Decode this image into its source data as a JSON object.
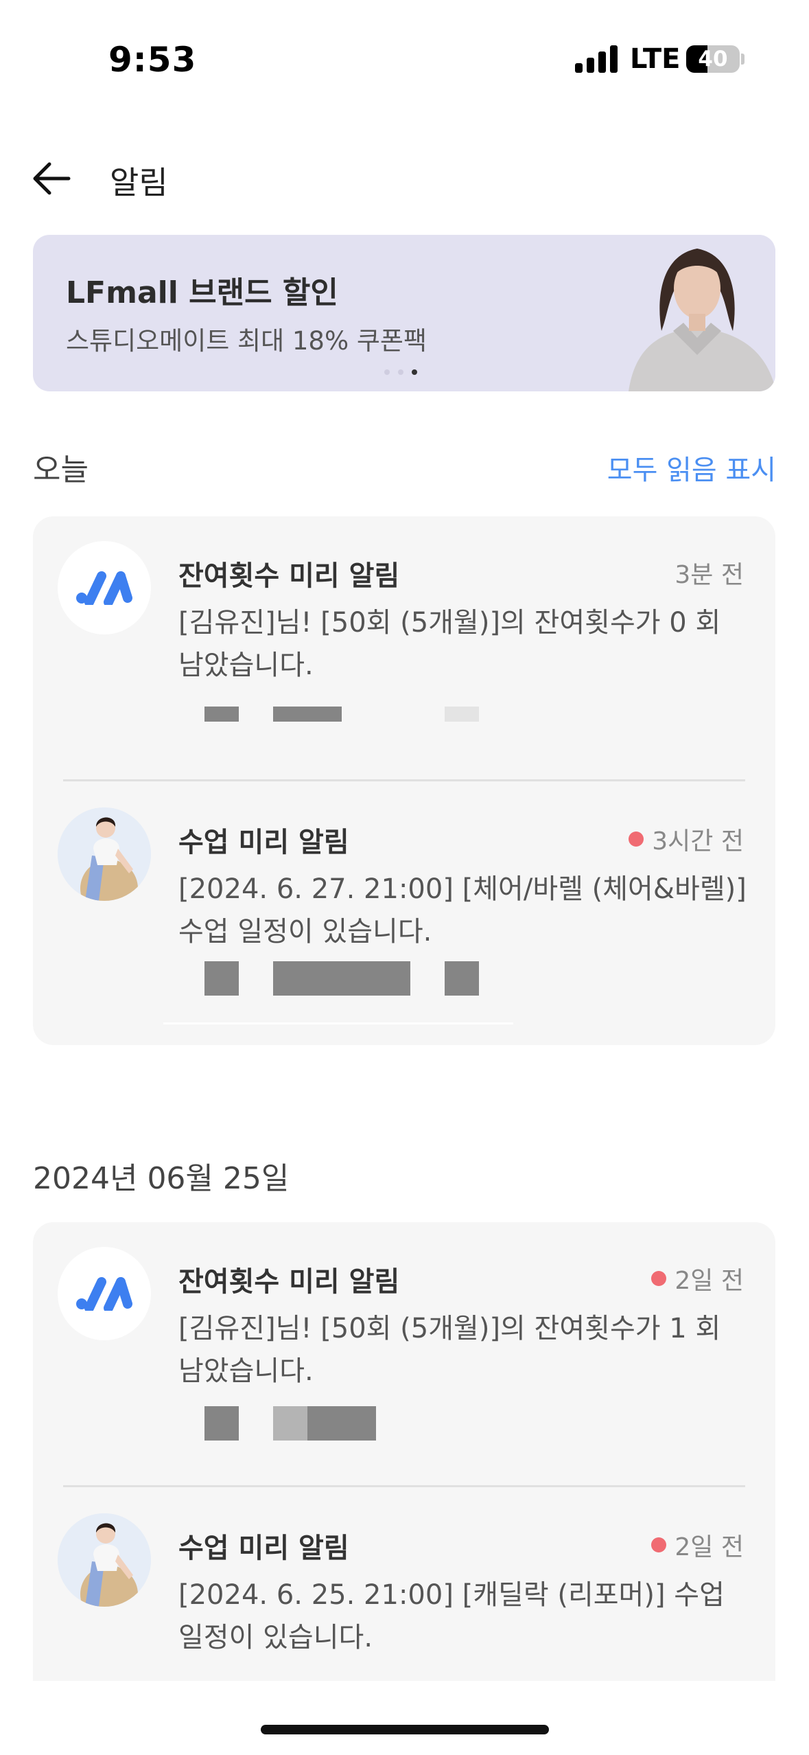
{
  "status_bar": {
    "time": "9:53",
    "network": "LTE",
    "battery": "40",
    "battery_level": 0.4
  },
  "header": {
    "title": "알림",
    "back_icon": "arrow-left-icon"
  },
  "banner": {
    "title": "LFmall 브랜드 할인",
    "subtitle": "스튜디오메이트 최대 18% 쿠폰팩",
    "page_count": 3,
    "active_page": 3
  },
  "sections": {
    "today": {
      "label": "오늘",
      "action": "모두 읽음 표시"
    },
    "date": {
      "label": "2024년 06월 25일"
    }
  },
  "notifications": [
    {
      "title": "잔여횟수 미리 알림",
      "time": "3분 전",
      "unread": false,
      "body": "[김유진]님! [50회 (5개월)]의 잔여횟수가 0 회 남았습니다.",
      "avatar": "app-logo-icon"
    },
    {
      "title": "수업 미리 알림",
      "time": "3시간 전",
      "unread": true,
      "body": "[2024. 6. 27. 21:00] [체어/바렐 (체어&바렐)] 수업 일정이 있습니다.",
      "avatar": "instructor-photo"
    },
    {
      "title": "잔여횟수 미리 알림",
      "time": "2일 전",
      "unread": true,
      "body": "[김유진]님! [50회 (5개월)]의 잔여횟수가 1 회 남았습니다.",
      "avatar": "app-logo-icon"
    },
    {
      "title": "수업 미리 알림",
      "time": "2일 전",
      "unread": true,
      "body": "[2024. 6. 25. 21:00] [캐딜락 (리포머)] 수업 일정이 있습니다.",
      "avatar": "instructor-photo"
    }
  ],
  "colors": {
    "accent": "#4b8ff2",
    "unread": "#f06b72",
    "banner_bg": "#e2e1f1",
    "card_bg": "#f6f6f6"
  }
}
